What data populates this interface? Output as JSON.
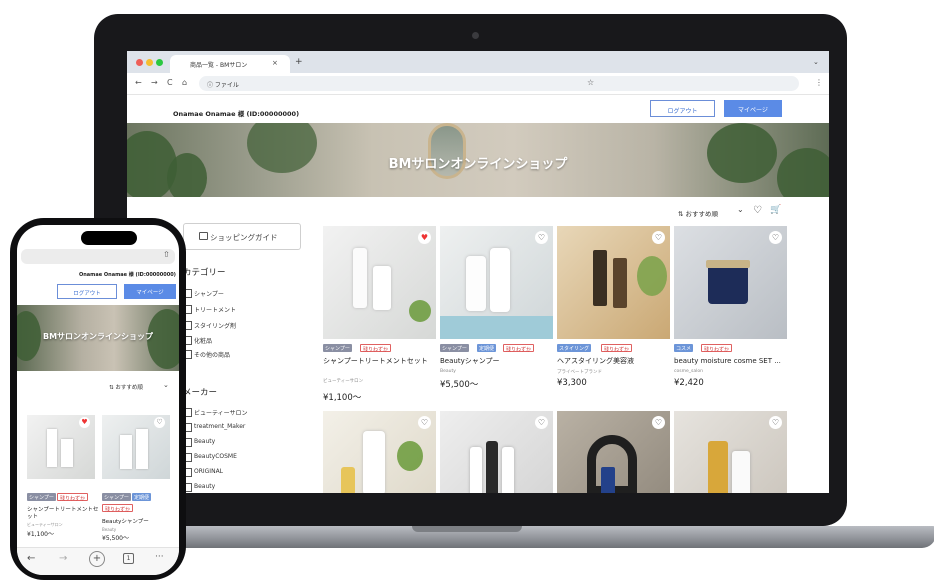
{
  "browser": {
    "tab_title": "商品一覧 - BMサロン",
    "tab_close": "×",
    "new_tab": "+",
    "tab_dropdown": "⌄",
    "back": "←",
    "forward": "→",
    "reload": "C",
    "home": "⌂",
    "url": "ⓘ ファイル",
    "bookmark": "☆",
    "menu": "⋮"
  },
  "header": {
    "user": "Onamae Onamae 様 (ID:00000000)",
    "logout": "ログアウト",
    "mypage": "マイページ"
  },
  "banner": {
    "title": "BMサロンオンラインショップ"
  },
  "toolbar": {
    "sort": "おすすめ順",
    "sort_caret": "⌄",
    "heart": "♡",
    "cart": "🛒"
  },
  "sidebar": {
    "guide": "ショッピングガイド",
    "category_title": "カテゴリー",
    "categories": [
      "シャンプー",
      "トリートメント",
      "スタイリング剤",
      "化粧品",
      "その他の商品"
    ],
    "maker_title": "メーカー",
    "makers": [
      "ビューティーサロン",
      "treatment_Maker",
      "Beauty",
      "BeautyCOSME",
      "ORIGINAL",
      "Beauty"
    ]
  },
  "products": [
    {
      "name": "シャンプートリートメントセット",
      "brand": "ビューティーサロン",
      "price": "¥1,100〜",
      "tags": [
        "シャンプー",
        "残りわずか"
      ],
      "favorite": true
    },
    {
      "name": "Beautyシャンプー",
      "brand": "Beauty",
      "price": "¥5,500〜",
      "tags": [
        "シャンプー",
        "定期便",
        "残りわずか"
      ],
      "favorite": false
    },
    {
      "name": "ヘアスタイリング美容液",
      "brand": "プライベートブランド",
      "price": "¥3,300",
      "tags": [
        "スタイリング",
        "残りわずか"
      ],
      "favorite": false
    },
    {
      "name": "beauty moisture cosme SET ...",
      "brand": "cosme_salon",
      "price": "¥2,420",
      "tags": [
        "コスメ",
        "残りわずか"
      ],
      "favorite": false
    }
  ],
  "phone": {
    "share": "⇧",
    "user": "Onamae Onamae 様 (ID:00000000)",
    "logout": "ログアウト",
    "mypage": "マイページ",
    "banner": "BMサロンオンラインショップ",
    "sort": "おすすめ順",
    "products": [
      {
        "name": "シャンプートリートメントセット",
        "brand": "ビューティーサロン",
        "price": "¥1,100〜",
        "tags": [
          "シャンプー",
          "残りわずか"
        ]
      },
      {
        "name": "Beautyシャンプー",
        "brand": "Beauty",
        "price": "¥5,500〜",
        "tags": [
          "シャンプー",
          "定期便",
          "残りわずか"
        ]
      }
    ],
    "nav": [
      "←",
      "→",
      "+",
      "1",
      "···"
    ]
  },
  "colors": {
    "accent": "#5b8be6",
    "tag_red": "#d04040",
    "tag_gray": "#8a8fa3",
    "tag_blue": "#6c95d8",
    "heart_active": "#ee3333"
  }
}
